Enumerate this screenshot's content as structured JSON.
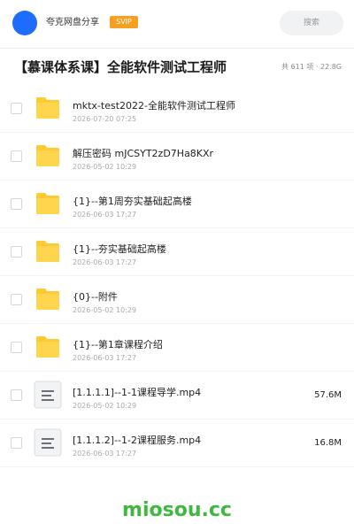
{
  "header": {
    "user_name": "夸克网盘分享",
    "badge": "SVIP",
    "search_label": "搜索"
  },
  "folder": {
    "title": "【慕课体系课】全能软件测试工程师",
    "meta": "共 611 项 · 22.8G"
  },
  "files": [
    {
      "name": "mktx-test2022-全能软件测试工程师",
      "date": "2026-07-20 07:25",
      "type": "folder",
      "size": ""
    },
    {
      "name": "解压密码 mJCSYT2zD7Ha8KXr",
      "date": "2026-05-02 10:29",
      "type": "folder",
      "size": ""
    },
    {
      "name": "{1}--第1周夯实基础起高楼",
      "date": "2026-06-03 17:27",
      "type": "folder",
      "size": ""
    },
    {
      "name": "{1}--夯实基础起高楼",
      "date": "2026-06-03 17:27",
      "type": "folder",
      "size": ""
    },
    {
      "name": "{0}--附件",
      "date": "2026-05-02 10:29",
      "type": "folder",
      "size": ""
    },
    {
      "name": "{1}--第1章课程介绍",
      "date": "2026-06-03 17:27",
      "type": "folder",
      "size": ""
    },
    {
      "name": "[1.1.1.1]--1-1课程导学.mp4",
      "date": "2026-05-02 10:29",
      "type": "file",
      "size": "57.6M"
    },
    {
      "name": "[1.1.1.2]--1-2课程服务.mp4",
      "date": "2026-06-03 17:27",
      "type": "file",
      "size": "16.8M"
    }
  ],
  "footer": {
    "watermark": "miosou.cc"
  },
  "colors": {
    "accent": "#1e6dfa",
    "svip": "#f6a021",
    "folder_yellow": "#ffc931",
    "watermark_green": "#3fb83f"
  }
}
